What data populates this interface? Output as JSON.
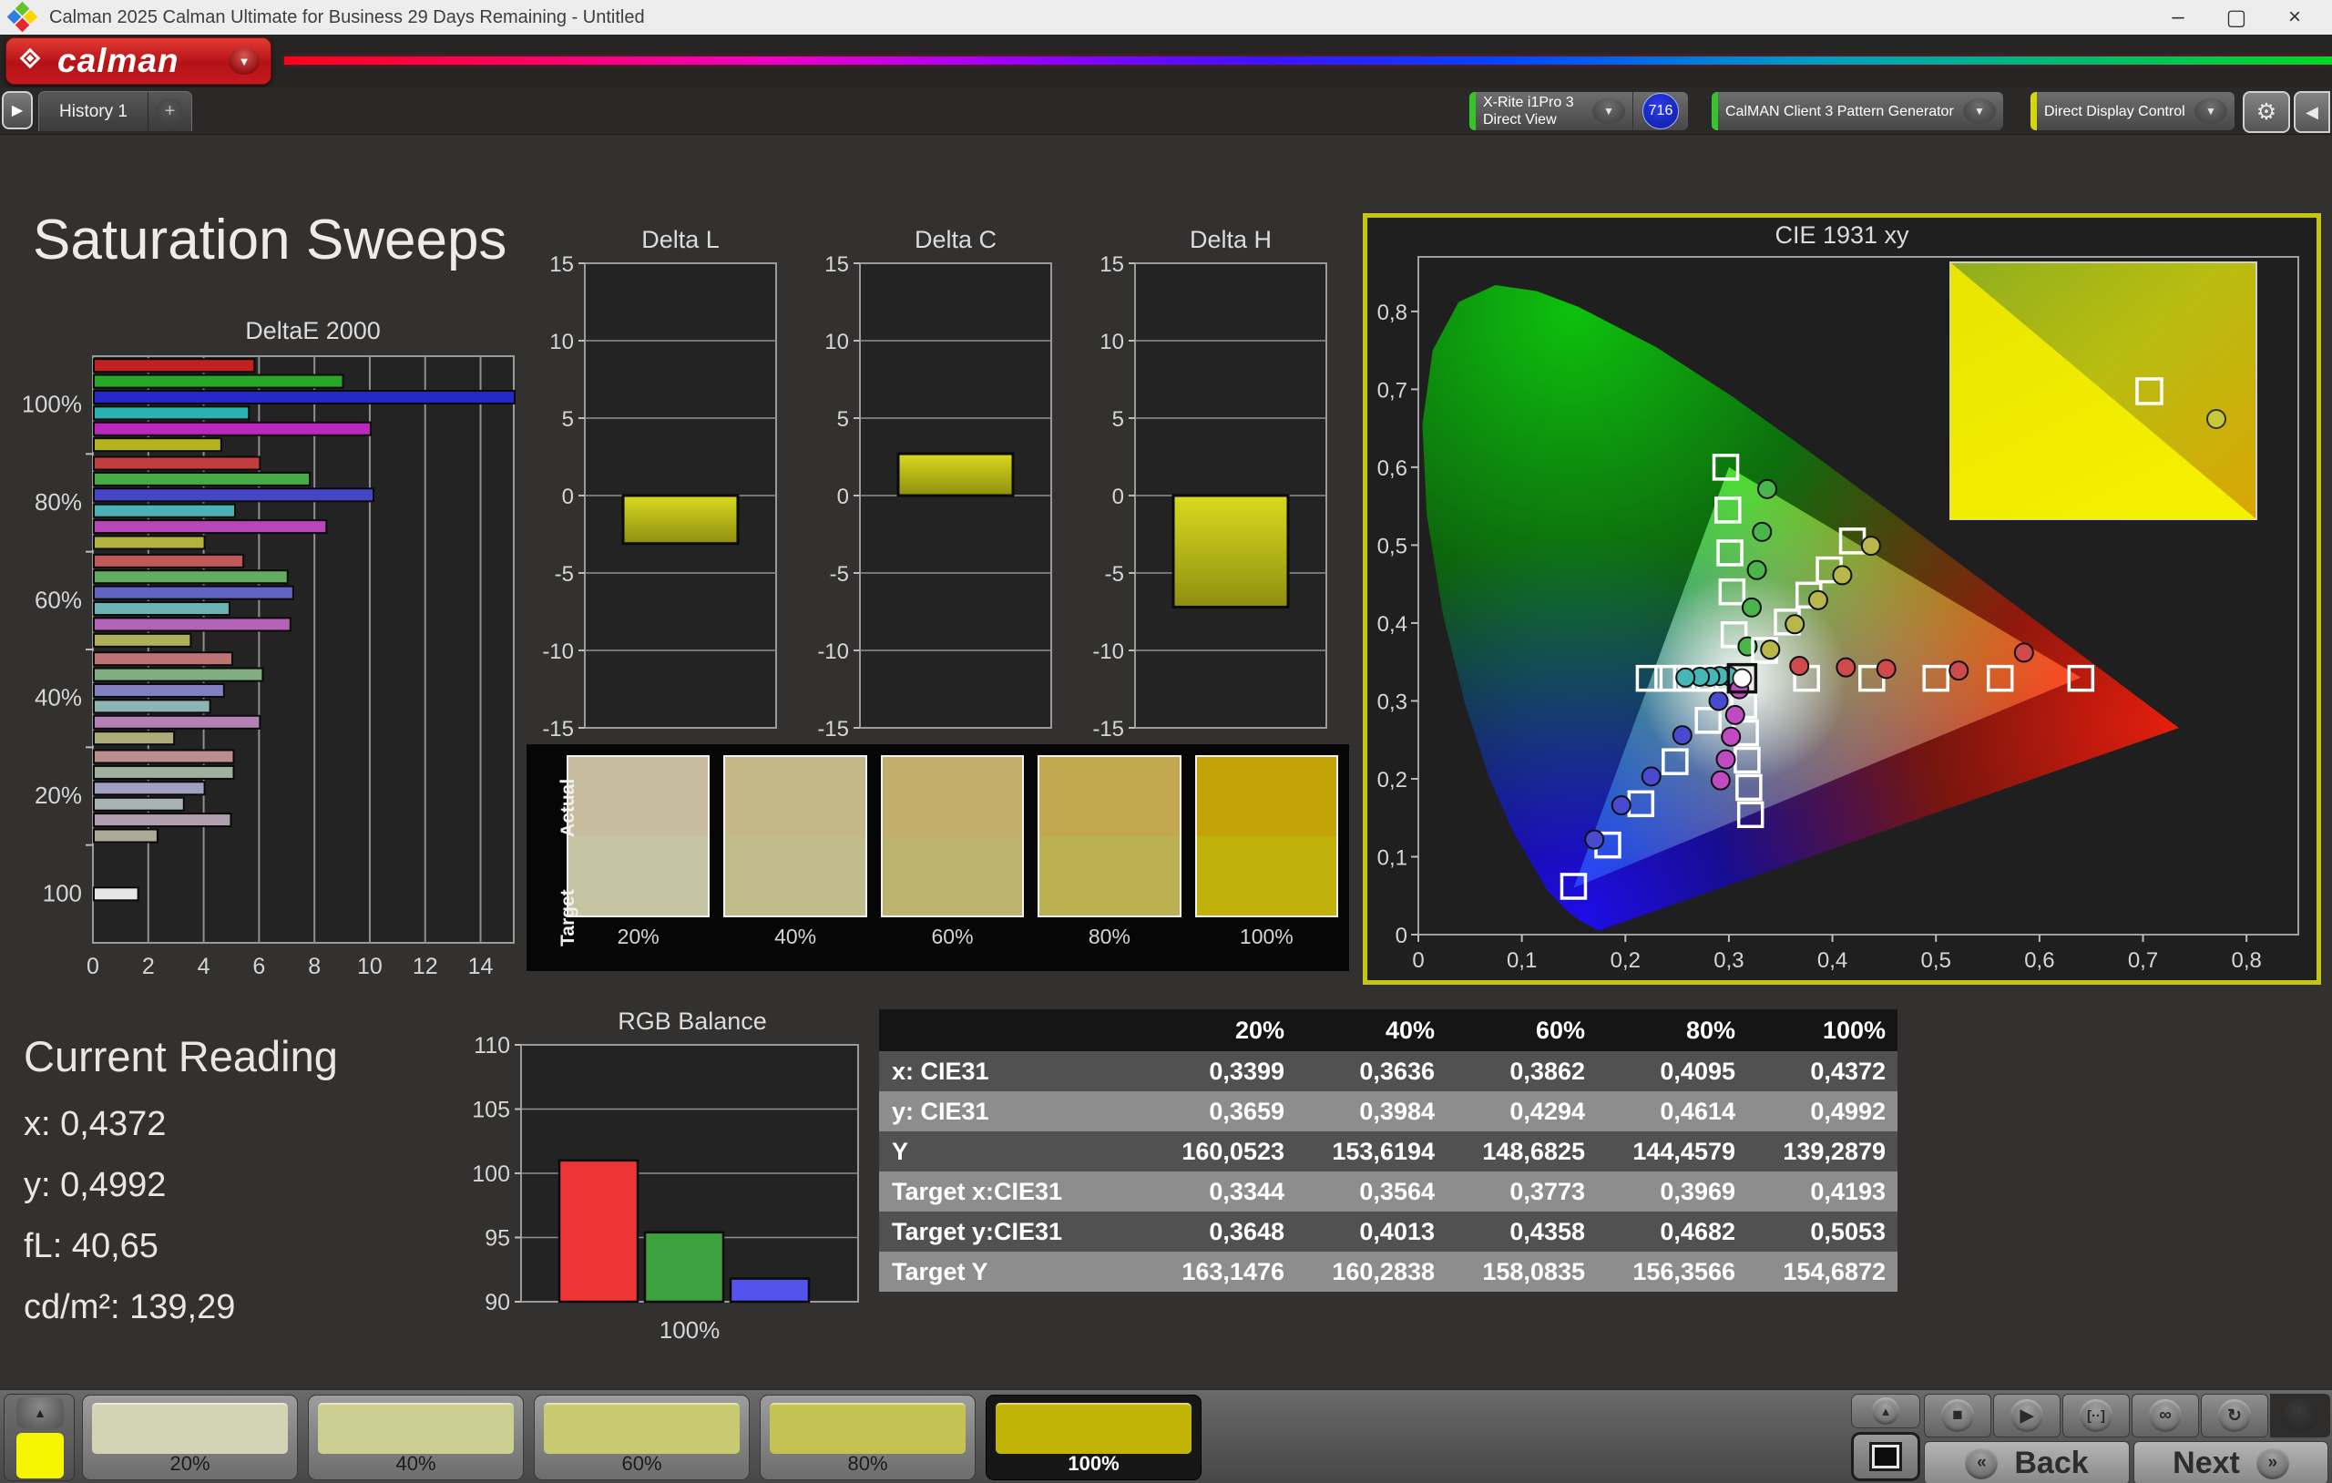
{
  "window": {
    "title": "Calman 2025 Calman Ultimate for Business 29 Days Remaining  - Untitled",
    "controls": {
      "minimize": "–",
      "maximize": "▢",
      "close": "×"
    }
  },
  "brand": {
    "logo_text": "calman"
  },
  "tabs": {
    "scroll_icon": "▶",
    "history_label": "History 1",
    "add_label": "+"
  },
  "toolbar": {
    "meter": {
      "line1": "X-Rite i1Pro 3",
      "line2": "Direct View",
      "badge": "716",
      "stripe": "#35c42a"
    },
    "source": {
      "label": "CalMAN Client 3 Pattern Generator",
      "stripe": "#35c42a"
    },
    "display": {
      "label": "Direct Display Control",
      "stripe": "#d6d60e"
    },
    "gear_icon": "⚙",
    "collapse_icon": "◀"
  },
  "page": {
    "title": "Saturation Sweeps"
  },
  "current_reading": {
    "title": "Current Reading",
    "lines": [
      "x: 0,4372",
      "y: 0,4992",
      "fL: 40,65",
      "cd/m²: 139,29"
    ]
  },
  "swatch_panel": {
    "row_labels": [
      "Actual",
      "Target"
    ],
    "columns": [
      {
        "label": "20%",
        "actual": "#c8bc9e",
        "target": "#c5c3a1"
      },
      {
        "label": "40%",
        "actual": "#c4b888",
        "target": "#c1bc8b"
      },
      {
        "label": "60%",
        "actual": "#c3ae6c",
        "target": "#bcb36f"
      },
      {
        "label": "80%",
        "actual": "#c1a84e",
        "target": "#bbb150"
      },
      {
        "label": "100%",
        "actual": "#c4a308",
        "target": "#c1b20b"
      }
    ]
  },
  "table": {
    "columns": [
      "20%",
      "40%",
      "60%",
      "80%",
      "100%"
    ],
    "rows": [
      {
        "label": "x: CIE31",
        "values": [
          "0,3399",
          "0,3636",
          "0,3862",
          "0,4095",
          "0,4372"
        ]
      },
      {
        "label": "y: CIE31",
        "values": [
          "0,3659",
          "0,3984",
          "0,4294",
          "0,4614",
          "0,4992"
        ]
      },
      {
        "label": "Y",
        "values": [
          "160,0523",
          "153,6194",
          "148,6825",
          "144,4579",
          "139,2879"
        ]
      },
      {
        "label": "Target x:CIE31",
        "values": [
          "0,3344",
          "0,3564",
          "0,3773",
          "0,3969",
          "0,4193"
        ]
      },
      {
        "label": "Target y:CIE31",
        "values": [
          "0,3648",
          "0,4013",
          "0,4358",
          "0,4682",
          "0,5053"
        ]
      },
      {
        "label": "Target Y",
        "values": [
          "163,1476",
          "160,2838",
          "158,0835",
          "156,3566",
          "154,6872"
        ]
      }
    ]
  },
  "bottom": {
    "swatches": [
      {
        "label": "20%",
        "color": "#d3d4b4",
        "selected": false
      },
      {
        "label": "40%",
        "color": "#cdcf92",
        "selected": false
      },
      {
        "label": "60%",
        "color": "#c8c971",
        "selected": false
      },
      {
        "label": "80%",
        "color": "#c3c252",
        "selected": false
      },
      {
        "label": "100%",
        "color": "#c2b406",
        "selected": true
      }
    ],
    "transport": [
      {
        "name": "stop",
        "glyph": "■"
      },
      {
        "name": "play",
        "glyph": "▶"
      },
      {
        "name": "frame",
        "glyph": "[··]"
      },
      {
        "name": "loop",
        "glyph": "∞"
      },
      {
        "name": "refresh",
        "glyph": "↻"
      }
    ],
    "back_label": "Back",
    "next_label": "Next",
    "back_icon": "«",
    "next_icon": "»",
    "up_icon": "▲"
  },
  "chart_data": [
    {
      "type": "bar",
      "orientation": "horizontal",
      "title": "DeltaE 2000",
      "xlim": [
        0,
        15.2
      ],
      "xticks": [
        0,
        2,
        4,
        6,
        8,
        10,
        12,
        14
      ],
      "series_names": [
        "red",
        "green",
        "blue",
        "cyan",
        "magenta",
        "yellow"
      ],
      "groups": [
        {
          "label": "100%",
          "values": [
            5.8,
            9.0,
            15.2,
            5.6,
            10.0,
            4.6
          ],
          "colors": [
            "#c42020",
            "#28a828",
            "#2428c8",
            "#28b2b2",
            "#bc28bc",
            "#b4b420"
          ]
        },
        {
          "label": "80%",
          "values": [
            6.0,
            7.8,
            10.1,
            5.1,
            8.4,
            4.0
          ],
          "colors": [
            "#c23d3d",
            "#46ab46",
            "#4446c6",
            "#4ab2b2",
            "#b846b8",
            "#b2b23e"
          ]
        },
        {
          "label": "60%",
          "values": [
            5.4,
            7.0,
            7.2,
            4.9,
            7.1,
            3.5
          ],
          "colors": [
            "#c05858",
            "#63ad63",
            "#6263c4",
            "#6cb3b3",
            "#b563b5",
            "#b0b05c"
          ]
        },
        {
          "label": "40%",
          "values": [
            5.0,
            6.1,
            4.7,
            4.2,
            6.0,
            2.9
          ],
          "colors": [
            "#bd7373",
            "#81ae81",
            "#8181c2",
            "#8eb3b3",
            "#b381b3",
            "#adad7a"
          ]
        },
        {
          "label": "20%",
          "values": [
            5.05,
            5.05,
            4.0,
            3.25,
            4.95,
            2.3
          ],
          "colors": [
            "#ba8e8e",
            "#9fb09f",
            "#a0a0c0",
            "#aab3b3",
            "#b09fb0",
            "#abab97"
          ]
        },
        {
          "label": "100",
          "values": [
            1.6
          ],
          "colors": [
            "#e6e6e6"
          ]
        }
      ]
    },
    {
      "type": "bar",
      "title": "Delta L",
      "ylim": [
        -15,
        15
      ],
      "yticks": [
        15,
        10,
        5,
        0,
        -5,
        -10,
        -15
      ],
      "categories": [
        "100%"
      ],
      "values": [
        -3.1
      ],
      "color": "#c2c21c"
    },
    {
      "type": "bar",
      "title": "Delta C",
      "ylim": [
        -15,
        15
      ],
      "yticks": [
        15,
        10,
        5,
        0,
        -5,
        -10,
        -15
      ],
      "categories": [
        "100%"
      ],
      "values": [
        2.7
      ],
      "color": "#c2c21c"
    },
    {
      "type": "bar",
      "title": "Delta H",
      "ylim": [
        -15,
        15
      ],
      "yticks": [
        15,
        10,
        5,
        0,
        -5,
        -10,
        -15
      ],
      "categories": [
        "100%"
      ],
      "values": [
        -7.2
      ],
      "color": "#c2c21c"
    },
    {
      "type": "bar",
      "title": "RGB Balance",
      "ylim": [
        90,
        110
      ],
      "yticks": [
        110,
        105,
        100,
        95,
        90
      ],
      "categories": [
        "100%"
      ],
      "series": [
        {
          "name": "red",
          "values": [
            101.0
          ],
          "color": "#ee3434"
        },
        {
          "name": "green",
          "values": [
            95.4
          ],
          "color": "#3da23d"
        },
        {
          "name": "blue",
          "values": [
            91.8
          ],
          "color": "#5353ee"
        }
      ]
    },
    {
      "type": "scatter",
      "title": "CIE 1931 xy",
      "xlim": [
        0,
        0.85
      ],
      "ylim": [
        0,
        0.87
      ],
      "xtick_labels": [
        "0",
        "0,1",
        "0,2",
        "0,3",
        "0,4",
        "0,5",
        "0,6",
        "0,7",
        "0,8"
      ],
      "ytick_labels": [
        "0",
        "0,1",
        "0,2",
        "0,3",
        "0,4",
        "0,5",
        "0,6",
        "0,7",
        "0,8"
      ],
      "gamut_triangle": [
        [
          0.64,
          0.33
        ],
        [
          0.3,
          0.6
        ],
        [
          0.15,
          0.06
        ]
      ],
      "white_point": {
        "x": 0.3127,
        "y": 0.329
      },
      "sweeps": [
        {
          "name": "red",
          "color": "#cf4a4a",
          "targets": [
            [
              0.375,
              0.329
            ],
            [
              0.438,
              0.329
            ],
            [
              0.5,
              0.329
            ],
            [
              0.562,
              0.329
            ],
            [
              0.64,
              0.329
            ]
          ],
          "measured": [
            [
              0.368,
              0.345
            ],
            [
              0.413,
              0.343
            ],
            [
              0.452,
              0.341
            ],
            [
              0.522,
              0.339
            ],
            [
              0.585,
              0.362
            ]
          ]
        },
        {
          "name": "green",
          "color": "#4ab54a",
          "targets": [
            [
              0.305,
              0.385
            ],
            [
              0.303,
              0.44
            ],
            [
              0.301,
              0.49
            ],
            [
              0.299,
              0.545
            ],
            [
              0.297,
              0.6
            ]
          ],
          "measured": [
            [
              0.318,
              0.37
            ],
            [
              0.322,
              0.42
            ],
            [
              0.327,
              0.468
            ],
            [
              0.332,
              0.517
            ],
            [
              0.337,
              0.572
            ]
          ]
        },
        {
          "name": "blue",
          "color": "#4a4ad1",
          "targets": [
            [
              0.28,
              0.275
            ],
            [
              0.248,
              0.222
            ],
            [
              0.215,
              0.168
            ],
            [
              0.183,
              0.115
            ],
            [
              0.15,
              0.062
            ]
          ],
          "measured": [
            [
              0.29,
              0.3
            ],
            [
              0.255,
              0.256
            ],
            [
              0.225,
              0.203
            ],
            [
              0.196,
              0.166
            ],
            [
              0.17,
              0.122
            ]
          ]
        },
        {
          "name": "cyan",
          "color": "#46b6b6",
          "targets": [
            [
              0.295,
              0.329
            ],
            [
              0.277,
              0.329
            ],
            [
              0.259,
              0.329
            ],
            [
              0.241,
              0.329
            ],
            [
              0.223,
              0.329
            ]
          ],
          "measured": [
            [
              0.3,
              0.332
            ],
            [
              0.291,
              0.332
            ],
            [
              0.282,
              0.331
            ],
            [
              0.272,
              0.331
            ],
            [
              0.258,
              0.33
            ]
          ]
        },
        {
          "name": "magenta",
          "color": "#c04ac0",
          "targets": [
            [
              0.3143,
              0.294
            ],
            [
              0.316,
              0.259
            ],
            [
              0.3176,
              0.224
            ],
            [
              0.3193,
              0.189
            ],
            [
              0.3209,
              0.154
            ]
          ],
          "measured": [
            [
              0.31,
              0.315
            ],
            [
              0.306,
              0.282
            ],
            [
              0.302,
              0.254
            ],
            [
              0.297,
              0.225
            ],
            [
              0.292,
              0.198
            ]
          ]
        },
        {
          "name": "yellow",
          "color": "#b8b84a",
          "targets": [
            [
              0.3344,
              0.3648
            ],
            [
              0.3564,
              0.4013
            ],
            [
              0.3773,
              0.4358
            ],
            [
              0.3969,
              0.4682
            ],
            [
              0.4193,
              0.5053
            ]
          ],
          "measured": [
            [
              0.3399,
              0.3659
            ],
            [
              0.3636,
              0.3984
            ],
            [
              0.3862,
              0.4294
            ],
            [
              0.4095,
              0.4614
            ],
            [
              0.4372,
              0.4992
            ]
          ]
        }
      ]
    }
  ]
}
